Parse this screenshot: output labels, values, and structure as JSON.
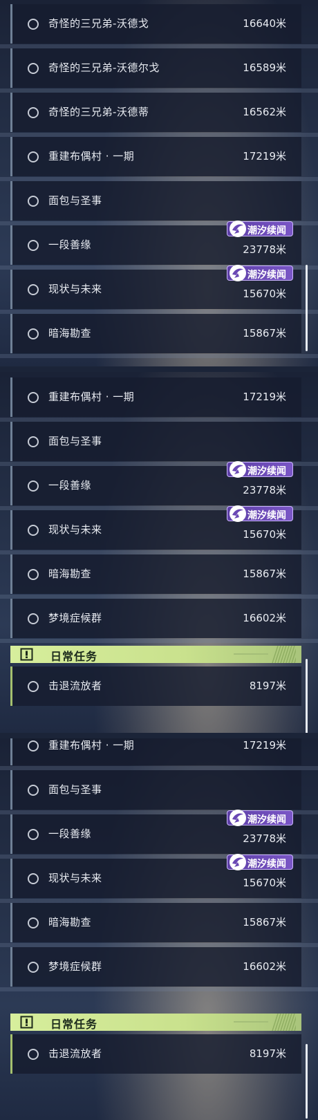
{
  "badge_label": "潮汐续闻",
  "daily_header": "日常任务",
  "panels": [
    {
      "top": 0,
      "height": 530,
      "rows": [
        {
          "title": "奇怪的三兄弟-沃德戈",
          "distance": "16640米",
          "badge": false
        },
        {
          "title": "奇怪的三兄弟-沃德尔戈",
          "distance": "16589米",
          "badge": false
        },
        {
          "title": "奇怪的三兄弟-沃德蒂",
          "distance": "16562米",
          "badge": false
        },
        {
          "title": "重建布偶村 · 一期",
          "distance": "17219米",
          "badge": false
        },
        {
          "title": "面包与圣事",
          "distance": "",
          "badge": false
        },
        {
          "title": "一段善缘",
          "distance": "23778米",
          "badge": true
        },
        {
          "title": "现状与未来",
          "distance": "15670米",
          "badge": true
        },
        {
          "title": "暗海勘查",
          "distance": "15867米",
          "badge": false
        }
      ]
    },
    {
      "rows": [
        {
          "title": "重建布偶村 · 一期",
          "distance": "17219米",
          "badge": false
        },
        {
          "title": "面包与圣事",
          "distance": "",
          "badge": false
        },
        {
          "title": "一段善缘",
          "distance": "23778米",
          "badge": true
        },
        {
          "title": "现状与未来",
          "distance": "15670米",
          "badge": true
        },
        {
          "title": "暗海勘查",
          "distance": "15867米",
          "badge": false
        },
        {
          "title": "梦境症候群",
          "distance": "16602米",
          "badge": false
        }
      ],
      "daily": [
        {
          "title": "击退流放者",
          "distance": "8197米"
        }
      ]
    },
    {
      "rows": [
        {
          "title": "重建布偶村 · 一期",
          "distance": "17219米",
          "badge": false
        },
        {
          "title": "面包与圣事",
          "distance": "",
          "badge": false
        },
        {
          "title": "一段善缘",
          "distance": "23778米",
          "badge": true
        },
        {
          "title": "现状与未来",
          "distance": "15670米",
          "badge": true
        },
        {
          "title": "暗海勘查",
          "distance": "15867米",
          "badge": false
        },
        {
          "title": "梦境症候群",
          "distance": "16602米",
          "badge": false
        }
      ],
      "daily": [
        {
          "title": "击退流放者",
          "distance": "8197米"
        }
      ]
    }
  ]
}
